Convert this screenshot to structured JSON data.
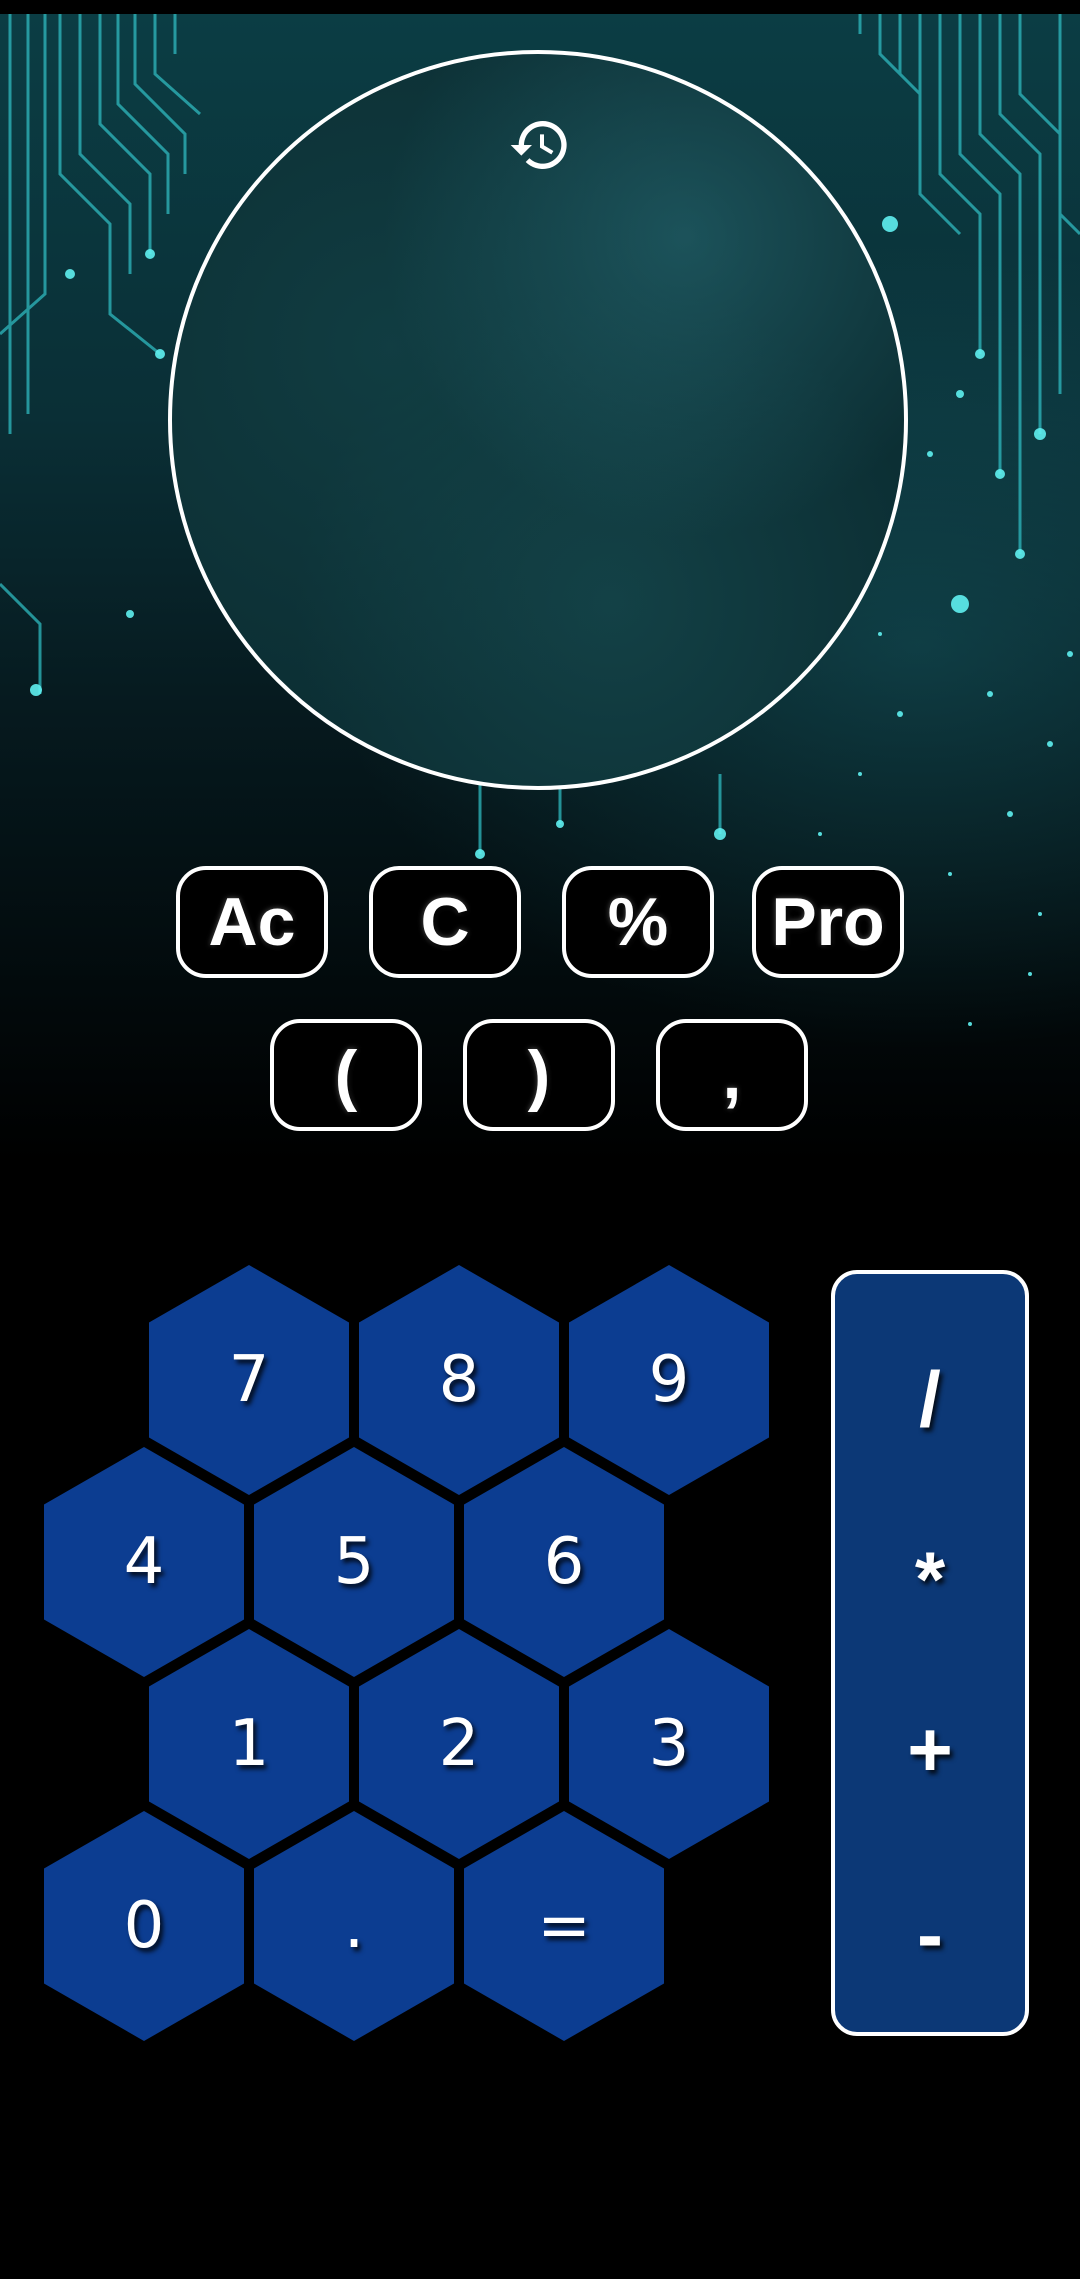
{
  "display": {
    "expression": "",
    "history_icon": "history-icon"
  },
  "functions": {
    "all_clear": "Ac",
    "clear": "C",
    "percent": "%",
    "pro": "Pro",
    "open_paren": "(",
    "close_paren": ")",
    "comma": ","
  },
  "keypad": {
    "k7": "7",
    "k8": "8",
    "k9": "9",
    "k4": "4",
    "k5": "5",
    "k6": "6",
    "k1": "1",
    "k2": "2",
    "k3": "3",
    "k0": "0",
    "dot": ".",
    "equals": "="
  },
  "operators": {
    "divide": "/",
    "multiply": "*",
    "add": "+",
    "subtract": "-"
  },
  "colors": {
    "hex_key": "#0c3d91",
    "ops_panel": "#0c3876",
    "outline": "#ffffff",
    "background_circuit": "#2fd0d8"
  }
}
